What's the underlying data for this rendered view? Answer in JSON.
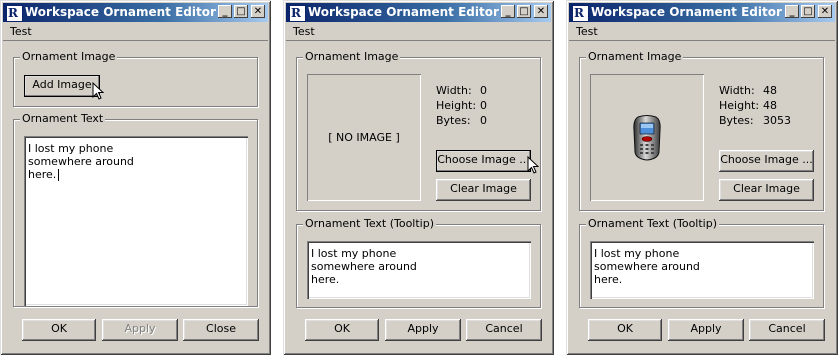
{
  "windows": [
    {
      "title": "Workspace Ornament Editor",
      "menu": "Test",
      "image_group_label": "Ornament Image",
      "add_image_label": "Add Image",
      "text_group_label": "Ornament Text",
      "text_lines": [
        "I lost my phone",
        "somewhere around",
        "here."
      ],
      "ok_label": "OK",
      "apply_label": "Apply",
      "close_label": "Close"
    },
    {
      "title": "Workspace Ornament Editor",
      "menu": "Test",
      "image_group_label": "Ornament Image",
      "no_image_label": "[ NO IMAGE ]",
      "width_label": "Width:",
      "width_value": "0",
      "height_label": "Height:",
      "height_value": "0",
      "bytes_label": "Bytes:",
      "bytes_value": "0",
      "choose_image_label": "Choose Image ...",
      "clear_image_label": "Clear Image",
      "text_group_label": "Ornament Text (Tooltip)",
      "text_lines": [
        "I lost my phone",
        "somewhere around",
        "here."
      ],
      "ok_label": "OK",
      "apply_label": "Apply",
      "cancel_label": "Cancel"
    },
    {
      "title": "Workspace Ornament Editor",
      "menu": "Test",
      "image_group_label": "Ornament Image",
      "image_icon": "mobile-phone-icon",
      "width_label": "Width:",
      "width_value": "48",
      "height_label": "Height:",
      "height_value": "48",
      "bytes_label": "Bytes:",
      "bytes_value": "3053",
      "choose_image_label": "Choose Image ...",
      "clear_image_label": "Clear Image",
      "text_group_label": "Ornament Text (Tooltip)",
      "text_lines": [
        "I lost my phone",
        "somewhere around",
        "here."
      ],
      "ok_label": "OK",
      "apply_label": "Apply",
      "cancel_label": "Cancel"
    }
  ],
  "colors": {
    "window_bg": "#d4d0c8",
    "title_start": "#0a246a",
    "title_end": "#a6caf0"
  }
}
